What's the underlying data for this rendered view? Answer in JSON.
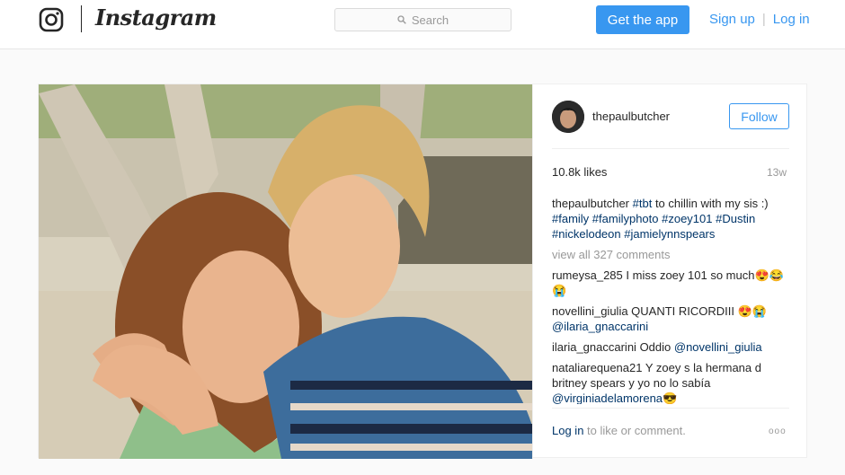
{
  "nav": {
    "brand": "Instagram",
    "search_placeholder": "Search",
    "get_app_label": "Get the app",
    "signup_label": "Sign up",
    "separator": "|",
    "login_label": "Log in"
  },
  "post": {
    "username": "thepaulbutcher",
    "follow_label": "Follow",
    "likes": "10.8k likes",
    "time_ago": "13w",
    "caption": {
      "user": "thepaulbutcher",
      "tag1": "#tbt",
      "text": " to chillin with my sis :) ",
      "tags": "#family #familyphoto #zoey101 #Dustin #nickelodeon #jamielynnspears"
    },
    "view_all": "view all 327 comments",
    "comments": [
      {
        "user": "rumeysa_285",
        "text": " I miss zoey 101 so much😍😂😭",
        "mention": ""
      },
      {
        "user": "novellini_giulia",
        "text": " QUANTI RICORDIII 😍😭 ",
        "mention": "@ilaria_gnaccarini"
      },
      {
        "user": "ilaria_gnaccarini",
        "text": " Oddio ",
        "mention": "@novellini_giulia"
      },
      {
        "user": "nataliarequena21",
        "text": " Y zoey s la hermana d britney spears y yo no lo sabía ",
        "mention": "@virginiadelamorena😎"
      }
    ],
    "login_link": "Log in",
    "login_suffix": " to like or comment.",
    "more_dots": "ooo"
  },
  "colors": {
    "accent": "#3897f0",
    "link": "#003569",
    "muted": "#999999"
  },
  "icons": {
    "logo": "instagram-glyph-icon",
    "search": "search-icon",
    "more": "more-options-icon"
  }
}
